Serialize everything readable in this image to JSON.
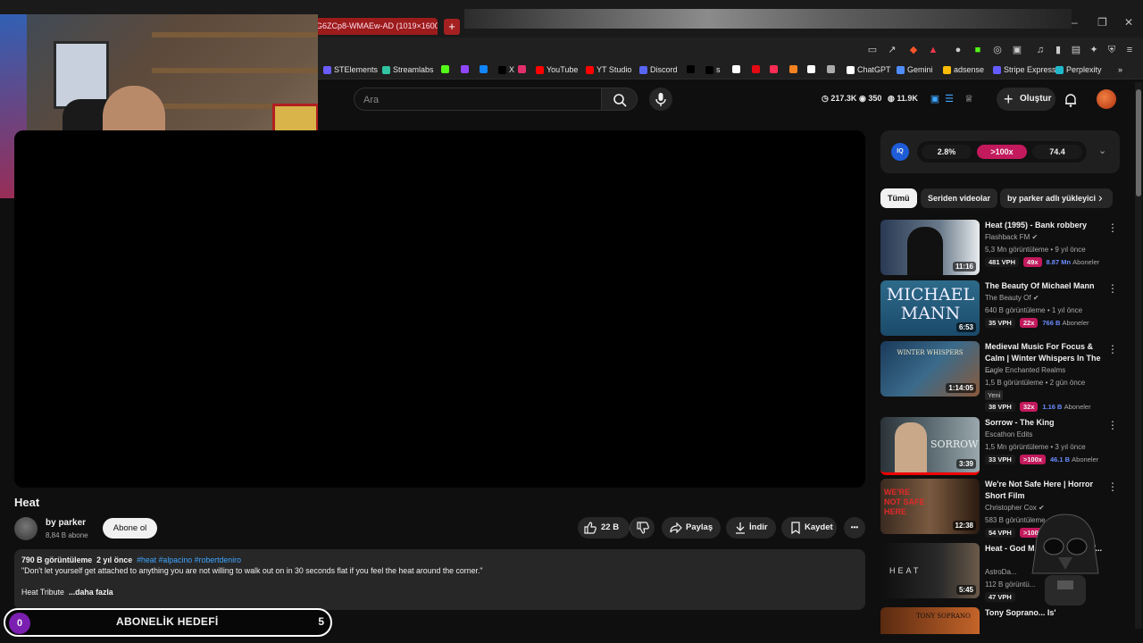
{
  "browser": {
    "active_tab_title": "G6ZCp8-WMAEw-AD (1019×1600)",
    "new_tab": "+",
    "window_controls": {
      "minimize": "–",
      "maximize": "❐",
      "close": "✕"
    },
    "bookmarks": [
      {
        "label": "STElements",
        "color": "#6a5cff"
      },
      {
        "label": "Streamlabs",
        "color": "#31c3a2"
      },
      {
        "label": "",
        "color": "#53fc18"
      },
      {
        "label": "",
        "color": "#9146ff"
      },
      {
        "label": "",
        "color": "#1185fe"
      },
      {
        "label": "X",
        "color": "#000000"
      },
      {
        "label": "",
        "color": "#e1306c"
      },
      {
        "label": "YouTube",
        "color": "#ff0000"
      },
      {
        "label": "YT Studio",
        "color": "#ff0000"
      },
      {
        "label": "Discord",
        "color": "#5865f2"
      },
      {
        "label": "",
        "color": "#000000"
      },
      {
        "label": "s",
        "color": "#000000"
      },
      {
        "label": "",
        "color": "#ffffff"
      },
      {
        "label": "",
        "color": "#e50914"
      },
      {
        "label": "",
        "color": "#ff2d55"
      },
      {
        "label": "",
        "color": "#f58220"
      },
      {
        "label": "",
        "color": "#ffffff"
      },
      {
        "label": "",
        "color": "#aaaaaa"
      },
      {
        "label": "ChatGPT",
        "color": "#ffffff"
      },
      {
        "label": "Gemini",
        "color": "#4f8dfd"
      },
      {
        "label": "adsense",
        "color": "#fbbc04"
      },
      {
        "label": "Stripe Express",
        "color": "#635bff"
      },
      {
        "label": "Perplexity",
        "color": "#20b8cd"
      },
      {
        "label": "»",
        "color": ""
      }
    ]
  },
  "header": {
    "search_placeholder": "Ara",
    "stats": {
      "views": "217.3K",
      "watching": "350",
      "subs": "11.9K"
    },
    "create_label": "Oluştur"
  },
  "video": {
    "title": "Heat",
    "channel": "by parker",
    "subscribers": "8,84 B abone",
    "subscribe_label": "Abone ol",
    "likes": "22 B",
    "share_label": "Paylaş",
    "download_label": "İndir",
    "save_label": "Kaydet",
    "more_label": "•••",
    "description": {
      "views": "790 B görüntüleme",
      "age": "2 yıl önce",
      "tags": "#heat #alpacino #robertdeniro",
      "quote": "\"Don't let yourself get attached to anything you are not willing to walk out on in 30 seconds flat if you feel the heat around the corner.\"",
      "tribute": "Heat Tribute",
      "more": "...daha fazla"
    }
  },
  "goal_overlay": {
    "current": "0",
    "label": "ABONELİK HEDEFİ",
    "target": "5"
  },
  "iq_panel": {
    "badge": "IQ",
    "value1": "2.8%",
    "value2": ">100x",
    "value3": "74.4",
    "chevron": "⌄"
  },
  "chips": [
    "Tümü",
    "Seriden videolar",
    "by parker adlı yükleyici"
  ],
  "recommendations": [
    {
      "title": "Heat (1995) - Bank robbery",
      "channel": "Flashback FM",
      "verified": true,
      "meta": "5,3 Mn görüntüleme • 9 yıl önce",
      "duration": "11:16",
      "vph": "481 VPH",
      "mult": "49x",
      "subs_value": "8.87 Mn",
      "subs_label": "Aboneler",
      "is_new": false,
      "new_label": ""
    },
    {
      "title": "The Beauty Of Michael Mann",
      "channel": "The Beauty Of",
      "verified": true,
      "meta": "640 B görüntüleme • 1 yıl önce",
      "duration": "6:53",
      "vph": "35 VPH",
      "mult": "22x",
      "subs_value": "766 B",
      "subs_label": "Aboneler",
      "is_new": false,
      "new_label": "",
      "thumb_text": "MICHAEL MANN"
    },
    {
      "title": "Medieval Music For Focus & Calm | Winter Whispers In The ...",
      "channel": "Eagle Enchanted Realms",
      "verified": false,
      "meta": "1,5 B görüntüleme • 2 gün önce",
      "duration": "1:14:05",
      "vph": "38 VPH",
      "mult": "32x",
      "subs_value": "1.16 B",
      "subs_label": "Aboneler",
      "is_new": true,
      "new_label": "Yeni",
      "thumb_text": "WINTER WHISPERS"
    },
    {
      "title": "Sorrow - The King",
      "channel": "Escathon Edits",
      "verified": false,
      "meta": "1,5 Mn görüntüleme • 3 yıl önce",
      "duration": "3:39",
      "vph": "33 VPH",
      "mult": ">100x",
      "subs_value": "46.1 B",
      "subs_label": "Aboneler",
      "is_new": false,
      "new_label": "",
      "thumb_text": "SORROW"
    },
    {
      "title": "We're Not Safe Here | Horror Short Film",
      "channel": "Christopher Cox",
      "verified": true,
      "meta": "583 B görüntüleme",
      "duration": "12:38",
      "vph": "54 VPH",
      "mult": ">100",
      "subs_value": "",
      "subs_label": "eler",
      "is_new": false,
      "new_label": "",
      "thumb_text": "WE'RE NOT SAFE HERE"
    },
    {
      "title": "Heat - God M... Face of the W...",
      "channel": "AstroDa...",
      "verified": false,
      "meta": "112 B görüntü...",
      "duration": "5:45",
      "vph": "47 VPH",
      "mult": "",
      "subs_value": "",
      "subs_label": "",
      "is_new": false,
      "new_label": "",
      "thumb_text": "HEAT"
    },
    {
      "title": "Tony Soprano... Is'",
      "channel": "",
      "verified": false,
      "meta": "",
      "duration": "",
      "vph": "",
      "mult": "",
      "subs_value": "",
      "subs_label": "",
      "is_new": false,
      "new_label": "",
      "thumb_text": "TONY SOPRANO"
    }
  ]
}
